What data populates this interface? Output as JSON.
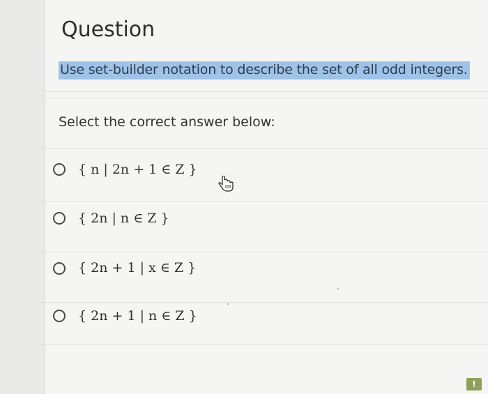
{
  "question": {
    "title": "Question",
    "prompt": "Use set-builder notation to describe the set of all odd integers.",
    "instruction": "Select the correct answer below:"
  },
  "options": [
    {
      "label": "{ n | 2n + 1 ∈ Z }"
    },
    {
      "label": "{ 2n | n ∈ Z }"
    },
    {
      "label": "{ 2n + 1 | x ∈ Z }"
    },
    {
      "label": "{ 2n + 1 | n ∈ Z }"
    }
  ],
  "colors": {
    "highlight": "#9fc3e8",
    "radio_border": "#4a4a4a",
    "card_bg": "#f5f5f3"
  },
  "icons": {
    "cursor": "hand-pointer-icon",
    "corner": "feedback-icon"
  }
}
